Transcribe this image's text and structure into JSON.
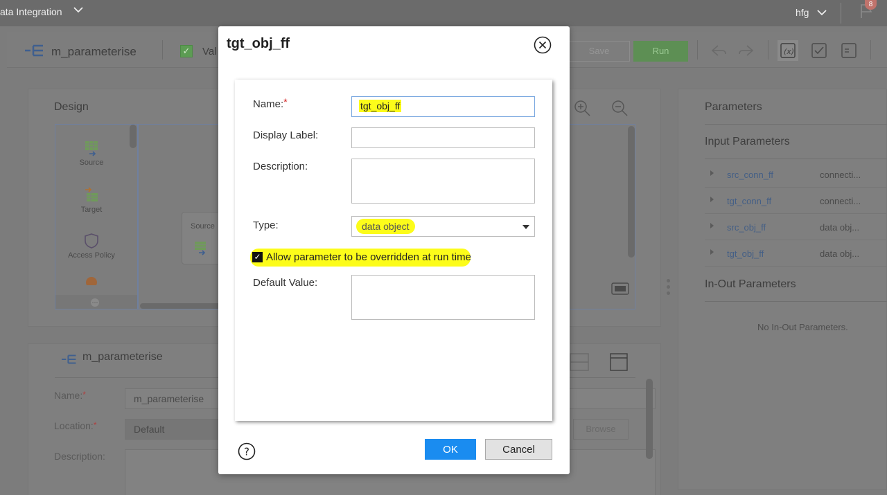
{
  "topbar": {
    "app_title": "ata Integration",
    "user": "hfg",
    "notification_count": "8"
  },
  "toolbar": {
    "mapping_name": "m_parameterise",
    "valid_label": "Val",
    "save_label": "Save",
    "run_label": "Run"
  },
  "design": {
    "title": "Design",
    "palette": [
      {
        "label": "Source",
        "icon": "source-icon"
      },
      {
        "label": "Target",
        "icon": "target-icon"
      },
      {
        "label": "Access Policy",
        "icon": "access-policy-icon"
      }
    ],
    "canvas_node_label": "Source"
  },
  "properties": {
    "title": "m_parameterise",
    "name_label": "Name:",
    "name_value": "m_parameterise",
    "location_label": "Location:",
    "location_value": "Default",
    "description_label": "Description:",
    "browse_label": "Browse"
  },
  "parameters": {
    "title": "Parameters",
    "input_title": "Input Parameters",
    "input_items": [
      {
        "name": "src_conn_ff",
        "type": "connecti..."
      },
      {
        "name": "tgt_conn_ff",
        "type": "connecti..."
      },
      {
        "name": "src_obj_ff",
        "type": "data obj..."
      },
      {
        "name": "tgt_obj_ff",
        "type": "data obj..."
      }
    ],
    "inout_title": "In-Out Parameters",
    "inout_empty": "No In-Out Parameters."
  },
  "dialog": {
    "title": "tgt_obj_ff",
    "name_label": "Name:",
    "required_mark": "*",
    "name_value": "tgt_obj_ff",
    "display_label_label": "Display Label:",
    "display_label_value": "",
    "description_label": "Description:",
    "type_label": "Type:",
    "type_value": "data object",
    "allow_override_label": "Allow parameter to be overridden at run time",
    "allow_override_checked": true,
    "default_value_label": "Default Value:",
    "ok_label": "OK",
    "cancel_label": "Cancel"
  },
  "colors": {
    "highlight": "#fcfc1a",
    "primary_button": "#1a8cf0",
    "required": "#d42020",
    "link": "#445f86"
  }
}
